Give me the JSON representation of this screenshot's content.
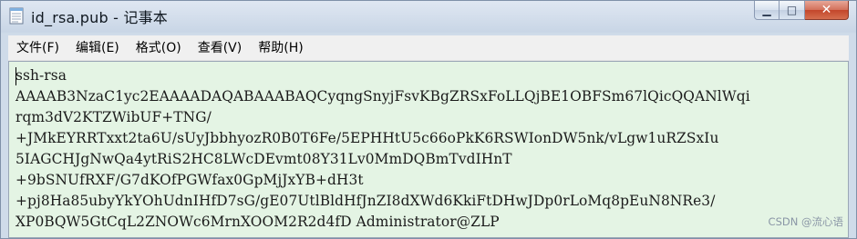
{
  "window": {
    "title": "id_rsa.pub - 记事本",
    "minimize_glyph": "▁",
    "maximize_glyph": "□",
    "close_glyph": "✕"
  },
  "menu": [
    {
      "label": "文件(F)"
    },
    {
      "label": "编辑(E)"
    },
    {
      "label": "格式(O)"
    },
    {
      "label": "查看(V)"
    },
    {
      "label": "帮助(H)"
    }
  ],
  "editor": {
    "lines": [
      "ssh-rsa",
      "AAAAB3NzaC1yc2EAAAADAQABAAABAQCyqngSnyjFsvKBgZRSxFoLLQjBE1OBFSm67lQicQQANlWqi",
      "rqm3dV2KTZWibUF+TNG/",
      "+JMkEYRRTxxt2ta6U/sUyJbbhyozR0B0T6Fe/5EPHHtU5c66oPkK6RSWIonDW5nk/vLgw1uRZSxIu",
      "5IAGCHJgNwQa4ytRiS2HC8LWcDEvmt08Y31Lv0MmDQBmTvdIHnT",
      "+9bSNUfRXF/G7dKOfPGWfax0GpMjJxYB+dH3t",
      "+pj8Ha85ubyYkYOhUdnIHfD7sG/gE07UtlBldHfJnZI8dXWd6KkiFtDHwJDp0rLoMq8pEuN8NRe3/",
      "XP0BQW5GtCqL2ZNOWc6MrnXOOM2R2d4fD Administrator@ZLP"
    ]
  },
  "watermark": "CSDN @流心语"
}
